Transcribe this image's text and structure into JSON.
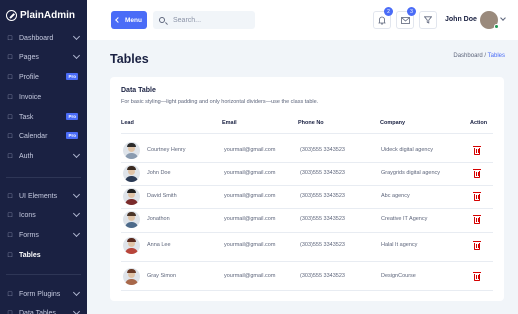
{
  "app": {
    "name": "PlainAdmin"
  },
  "sidebar": {
    "items": [
      {
        "label": "Dashboard",
        "icon": "dashboard-icon",
        "chevron": true
      },
      {
        "label": "Pages",
        "icon": "pages-icon",
        "chevron": true
      },
      {
        "label": "Profile",
        "icon": "user-icon",
        "pro": "Pro"
      },
      {
        "label": "Invoice",
        "icon": "invoice-icon"
      },
      {
        "label": "Task",
        "icon": "task-icon",
        "pro": "Pro"
      },
      {
        "label": "Calendar",
        "icon": "calendar-icon",
        "pro": "Pro"
      },
      {
        "label": "Auth",
        "icon": "lock-icon",
        "chevron": true
      },
      {
        "label": "UI Elements",
        "icon": "ui-elements-icon",
        "chevron": true
      },
      {
        "label": "Icons",
        "icon": "icons-icon",
        "chevron": true
      },
      {
        "label": "Forms",
        "icon": "forms-icon",
        "chevron": true
      },
      {
        "label": "Tables",
        "icon": "tables-icon",
        "active": true
      },
      {
        "label": "Form Plugins",
        "icon": "plugins-icon",
        "chevron": true
      },
      {
        "label": "Data Tables",
        "icon": "data-tables-icon",
        "chevron": true
      }
    ]
  },
  "header": {
    "menu_label": "Menu",
    "search_placeholder": "Search...",
    "notification_count": "2",
    "message_count": "3",
    "user_name": "John Doe"
  },
  "page": {
    "title": "Tables",
    "breadcrumb": [
      "Dashboard",
      "/",
      "Tables"
    ]
  },
  "card": {
    "title": "Data Table",
    "subtitle": "For basic styling—light padding and only horizontal dividers—use the class table.",
    "columns": [
      "Lead",
      "Email",
      "Phone No",
      "Company",
      "Action"
    ],
    "rows": [
      {
        "name": "Courtney Henry",
        "email": "yourmail@gmail.com",
        "phone": "(303)555 3343523",
        "company": "Uideck digital agency",
        "hair": "#2b2b2b",
        "shirt": "#8a9bb0"
      },
      {
        "name": "John Doe",
        "email": "yourmail@gmail.com",
        "phone": "(303)555 3343523",
        "company": "Graygrids digital agency",
        "hair": "#3a2a20",
        "shirt": "#2a3a55"
      },
      {
        "name": "David Smith",
        "email": "yourmail@gmail.com",
        "phone": "(303)555 3343523",
        "company": "Abc agency",
        "hair": "#1f1f1f",
        "shirt": "#7a2b2b"
      },
      {
        "name": "Jonathon",
        "email": "yourmail@gmail.com",
        "phone": "(303)555 3343523",
        "company": "Creative IT Agency",
        "hair": "#4a3528",
        "shirt": "#4d6a8a"
      },
      {
        "name": "Anna Lee",
        "email": "yourmail@gmail.com",
        "phone": "(303)555 3343523",
        "company": "Halal It agency",
        "hair": "#5a2a1e",
        "shirt": "#b8453a"
      },
      {
        "name": "Gray Simon",
        "email": "yourmail@gmail.com",
        "phone": "(303)555 3343523",
        "company": "DesignCourse",
        "hair": "#6b3a26",
        "shirt": "#a8684a"
      }
    ]
  },
  "colors": {
    "sidebar_bg": "#1a2142",
    "primary": "#4a6cf7",
    "danger": "#d50100",
    "page_bg": "#f1f5f9"
  }
}
